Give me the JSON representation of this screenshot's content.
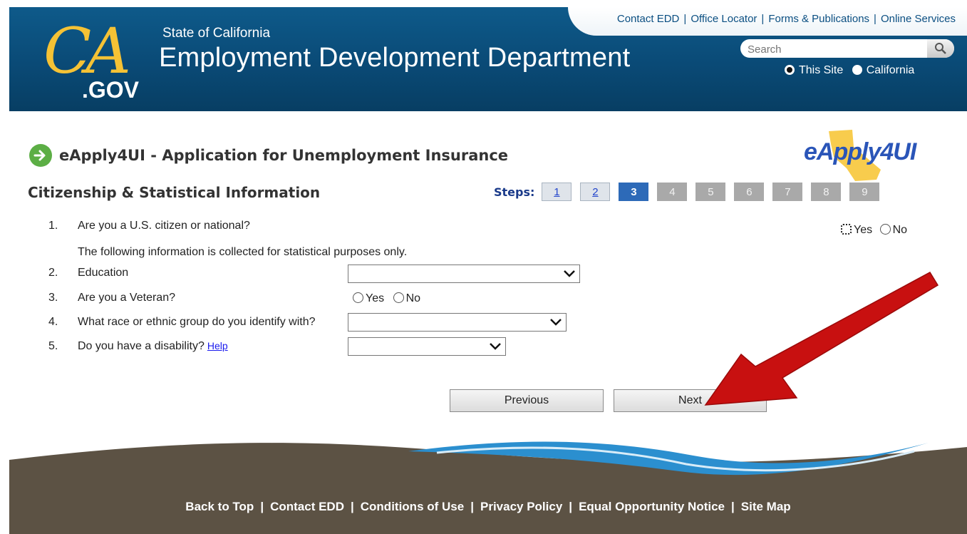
{
  "header": {
    "nav": [
      "Contact EDD",
      "Office Locator",
      "Forms & Publications",
      "Online Services"
    ],
    "logo_ca": "CA",
    "logo_gov": ".GOV",
    "state_of": "State of California",
    "dept": "Employment Development Department",
    "search_placeholder": "Search",
    "scope_options": [
      "This Site",
      "California"
    ],
    "scope_selected": "This Site"
  },
  "app": {
    "title": "eApply4UI - Application for Unemployment Insurance",
    "badge": "eApply4UI",
    "section_title": "Citizenship & Statistical Information",
    "steps_label": "Steps:",
    "steps": [
      "1",
      "2",
      "3",
      "4",
      "5",
      "6",
      "7",
      "8",
      "9"
    ],
    "current_step": "3"
  },
  "form": {
    "q1": {
      "num": "1.",
      "text": "Are you a U.S. citizen or national?",
      "yes": "Yes",
      "no": "No"
    },
    "note": "The following information is collected for statistical purposes only.",
    "q2": {
      "num": "2.",
      "text": "Education"
    },
    "q3": {
      "num": "3.",
      "text": "Are you a Veteran?",
      "yes": "Yes",
      "no": "No"
    },
    "q4": {
      "num": "4.",
      "text": "What race or ethnic group do you identify with?"
    },
    "q5": {
      "num": "5.",
      "text": "Do you have a disability?",
      "help": "Help"
    }
  },
  "buttons": {
    "previous": "Previous",
    "next": "Next"
  },
  "footer": {
    "links": [
      "Back to Top",
      "Contact EDD",
      "Conditions of Use",
      "Privacy Policy",
      "Equal Opportunity Notice",
      "Site Map"
    ]
  },
  "colors": {
    "header_blue": "#0a4a76",
    "gold": "#f5c235",
    "footer_brown": "#5c5244",
    "step_current": "#2d6ab8",
    "arrow_red": "#c81010"
  }
}
